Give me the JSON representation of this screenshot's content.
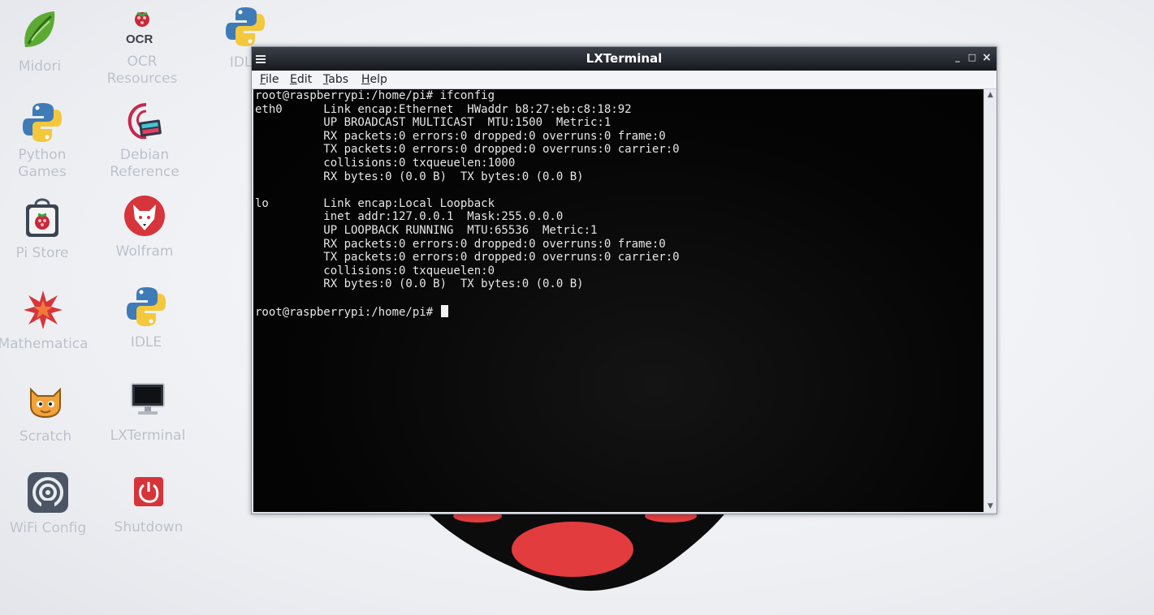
{
  "desktop": {
    "icons": [
      {
        "label": "Midori",
        "icon": "midori-leaf-icon"
      },
      {
        "label": "OCR\nResources",
        "icon": "ocr-resources-icon"
      },
      {
        "label": "IDLE",
        "icon": "python-icon"
      },
      {
        "label": "Python\nGames",
        "icon": "python-icon"
      },
      {
        "label": "Debian\nReference",
        "icon": "debian-reference-icon"
      },
      {
        "label": "Pi Store",
        "icon": "pi-store-bag-icon"
      },
      {
        "label": "Wolfram",
        "icon": "wolfram-wolf-icon"
      },
      {
        "label": "Mathematica",
        "icon": "mathematica-star-icon"
      },
      {
        "label": "IDLE",
        "icon": "python-icon"
      },
      {
        "label": "Scratch",
        "icon": "scratch-cat-icon"
      },
      {
        "label": "LXTerminal",
        "icon": "monitor-icon"
      },
      {
        "label": "WiFi Config",
        "icon": "wifi-config-icon"
      },
      {
        "label": "Shutdown",
        "icon": "power-icon"
      }
    ],
    "ocr_icon_text": "OCR"
  },
  "window": {
    "title": "LXTerminal",
    "controls": {
      "minimize": "_",
      "maximize": "□",
      "close": "×"
    },
    "menu": [
      {
        "mnemonic": "F",
        "rest": "ile"
      },
      {
        "mnemonic": "E",
        "rest": "dit"
      },
      {
        "mnemonic": "T",
        "rest": "abs"
      },
      {
        "mnemonic": "H",
        "rest": "elp"
      }
    ]
  },
  "terminal": {
    "lines": [
      "root@raspberrypi:/home/pi# ifconfig",
      "eth0      Link encap:Ethernet  HWaddr b8:27:eb:c8:18:92",
      "          UP BROADCAST MULTICAST  MTU:1500  Metric:1",
      "          RX packets:0 errors:0 dropped:0 overruns:0 frame:0",
      "          TX packets:0 errors:0 dropped:0 overruns:0 carrier:0",
      "          collisions:0 txqueuelen:1000",
      "          RX bytes:0 (0.0 B)  TX bytes:0 (0.0 B)",
      "",
      "lo        Link encap:Local Loopback",
      "          inet addr:127.0.0.1  Mask:255.0.0.0",
      "          UP LOOPBACK RUNNING  MTU:65536  Metric:1",
      "          RX packets:0 errors:0 dropped:0 overruns:0 frame:0",
      "          TX packets:0 errors:0 dropped:0 overruns:0 carrier:0",
      "          collisions:0 txqueuelen:0",
      "          RX bytes:0 (0.0 B)  TX bytes:0 (0.0 B)",
      ""
    ],
    "prompt": "root@raspberrypi:/home/pi# "
  },
  "colors": {
    "raspberry_red": "#d9323a",
    "terminal_bg": "#030303",
    "terminal_fg": "#e6e6e6",
    "titlebar": "#1c1f24"
  }
}
